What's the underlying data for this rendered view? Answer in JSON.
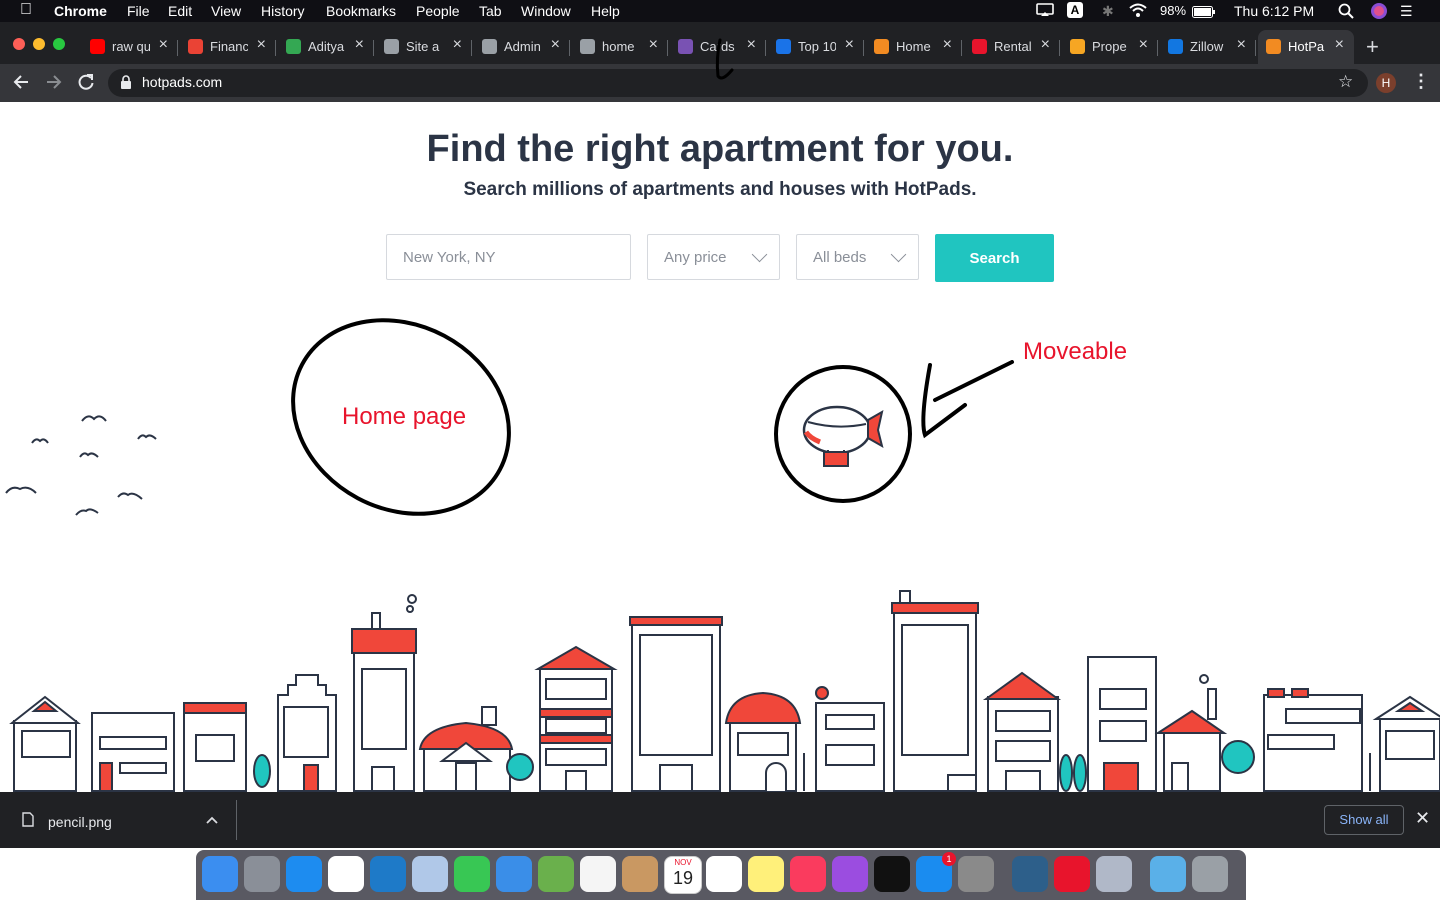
{
  "menubar": {
    "app": "Chrome",
    "items": [
      "File",
      "Edit",
      "View",
      "History",
      "Bookmarks",
      "People",
      "Tab",
      "Window",
      "Help"
    ],
    "battery": "98%",
    "clock": "Thu 6:12 PM",
    "input_source": "A"
  },
  "tabs": [
    {
      "label": "raw qu",
      "color": "#ff0000"
    },
    {
      "label": "Financ",
      "color": "#ea4335"
    },
    {
      "label": "Aditya",
      "color": "#34a853"
    },
    {
      "label": "Site a",
      "color": "#9aa0a6"
    },
    {
      "label": "Admin",
      "color": "#9aa0a6"
    },
    {
      "label": "home",
      "color": "#9aa0a6"
    },
    {
      "label": "Cards",
      "color": "#7952b3"
    },
    {
      "label": "Top 10",
      "color": "#1a73e8"
    },
    {
      "label": "Home",
      "color": "#f28b22"
    },
    {
      "label": "Rental",
      "color": "#e8142c"
    },
    {
      "label": "Prope",
      "color": "#f6a623"
    },
    {
      "label": "Zillow",
      "color": "#1277e1"
    },
    {
      "label": "HotPa",
      "color": "#f28b22",
      "active": true
    }
  ],
  "address_bar": {
    "url": "hotpads.com",
    "profile_initial": "H"
  },
  "page": {
    "title": "Find the right apartment for you.",
    "subtitle": "Search millions of apartments and houses with HotPads.",
    "location_placeholder": "New York, NY",
    "price_select": "Any price",
    "beds_select": "All beds",
    "search_label": "Search",
    "brand_accent": "#20c5c0",
    "house_accent": "#f0473a"
  },
  "annotations": {
    "home_page": "Home page",
    "moveable": "Moveable"
  },
  "download": {
    "filename": "pencil.png",
    "show_all": "Show all"
  },
  "dock": {
    "calendar_month": "NOV",
    "calendar_day": "19",
    "appstore_badge": "1",
    "icons": [
      "finder-icon",
      "launchpad-icon",
      "safari-icon",
      "chrome-icon",
      "vscode-icon",
      "preview-icon",
      "facetime-icon",
      "messages-icon",
      "maps-icon",
      "photos-icon",
      "contacts-icon",
      "calendar-icon",
      "reminders-icon",
      "notes-icon",
      "music-icon",
      "podcasts-icon",
      "tv-icon",
      "appstore-icon",
      "system-preferences-icon",
      "mysql-icon",
      "anydesk-icon",
      "image-viewer-icon",
      "folder-icon",
      "trash-icon"
    ]
  }
}
